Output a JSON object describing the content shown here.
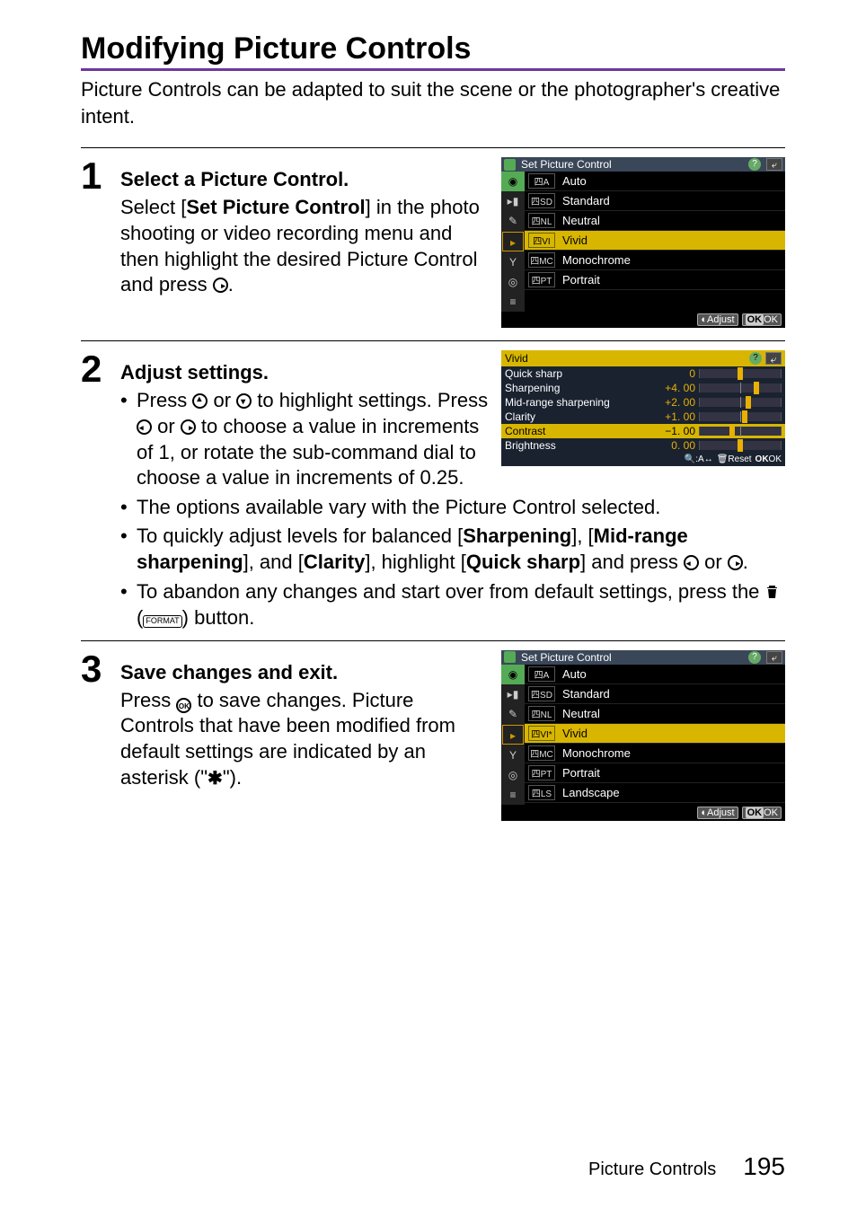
{
  "title": "Modifying Picture Controls",
  "intro": "Picture Controls can be adapted to suit the scene or the photographer's creative intent.",
  "steps": {
    "s1": {
      "num": "1",
      "heading": "Select a Picture Control.",
      "body_pre": "Select [",
      "body_bold": "Set Picture Control",
      "body_post": "] in the photo shooting or video recording menu and then highlight the desired Picture Control and press "
    },
    "s2": {
      "num": "2",
      "heading": "Adjust settings.",
      "b1_a": "Press ",
      "b1_b": " or ",
      "b1_c": " to highlight settings. Press ",
      "b1_d": " or ",
      "b1_e": " to choose a value in increments of 1, or rotate the sub-command dial to choose a value in increments of 0.25.",
      "b2": "The options available vary with the Picture Control selected.",
      "b3_a": "To quickly adjust levels for balanced [",
      "b3_b": "Sharpening",
      "b3_c": "], [",
      "b3_d": "Mid-range sharpening",
      "b3_e": "], and [",
      "b3_f": "Clarity",
      "b3_g": "], highlight [",
      "b3_h": "Quick sharp",
      "b3_i": "] and press ",
      "b3_j": " or ",
      "b3_k": ".",
      "b4_a": "To abandon any changes and start over from default settings, press the ",
      "b4_b": " (",
      "b4_c": ") button."
    },
    "s3": {
      "num": "3",
      "heading": "Save changes and exit.",
      "body_a": "Press ",
      "body_b": " to save changes. Picture Controls that have been modified from default settings are indicated by an asterisk (\"",
      "body_c": "\")."
    }
  },
  "menu1": {
    "title": "Set Picture Control",
    "items": [
      {
        "tag": "四A",
        "label": "Auto"
      },
      {
        "tag": "四SD",
        "label": "Standard"
      },
      {
        "tag": "四NL",
        "label": "Neutral"
      },
      {
        "tag": "四VI",
        "label": "Vivid"
      },
      {
        "tag": "四MC",
        "label": "Monochrome"
      },
      {
        "tag": "四PT",
        "label": "Portrait"
      }
    ],
    "hl": 3,
    "footer_adjust": "Adjust",
    "footer_ok": "OK"
  },
  "adj": {
    "title": "Vivid",
    "rows": [
      {
        "label": "Quick sharp",
        "val": "0",
        "markPct": 50
      },
      {
        "label": "Sharpening",
        "val": "+4. 00",
        "markPct": 70
      },
      {
        "label": "Mid-range sharpening",
        "val": "+2. 00",
        "markPct": 60
      },
      {
        "label": "Clarity",
        "val": "+1. 00",
        "markPct": 55
      },
      {
        "label": "Contrast",
        "val": "−1. 00",
        "markPct": 40
      },
      {
        "label": "Brightness",
        "val": "0. 00",
        "markPct": 50
      }
    ],
    "hl": 4,
    "footer_zoom": "A",
    "footer_reset": "Reset",
    "footer_ok": "OK"
  },
  "menu3": {
    "title": "Set Picture Control",
    "items": [
      {
        "tag": "四A",
        "label": "Auto"
      },
      {
        "tag": "四SD",
        "label": "Standard"
      },
      {
        "tag": "四NL",
        "label": "Neutral"
      },
      {
        "tag": "四VI*",
        "label": "Vivid"
      },
      {
        "tag": "四MC",
        "label": "Monochrome"
      },
      {
        "tag": "四PT",
        "label": "Portrait"
      },
      {
        "tag": "四LS",
        "label": "Landscape"
      }
    ],
    "hl": 3,
    "footer_adjust": "Adjust",
    "footer_ok": "OK"
  },
  "icons": {
    "format_label": "FORMAT"
  },
  "footer": {
    "section": "Picture Controls",
    "page": "195"
  }
}
